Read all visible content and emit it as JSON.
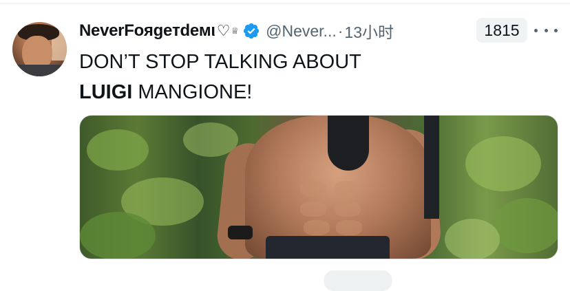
{
  "tweet": {
    "display_name": "NeverFoяgeтdeмι",
    "name_emoji_heart": "♡",
    "name_emoji_crown": "♕",
    "verified": true,
    "handle": "@Never...",
    "separator": "·",
    "time": "13小时",
    "count_badge": "1815",
    "text_line1": "DON’T STOP TALKING ABOUT",
    "text_bold": "LUIGI",
    "text_rest": " MANGIONE!"
  },
  "colors": {
    "verified_blue": "#1d9bf0",
    "secondary_text": "#536471",
    "badge_bg": "#eff3f4"
  },
  "icons": [
    "verified-badge-icon",
    "more-options-icon"
  ]
}
